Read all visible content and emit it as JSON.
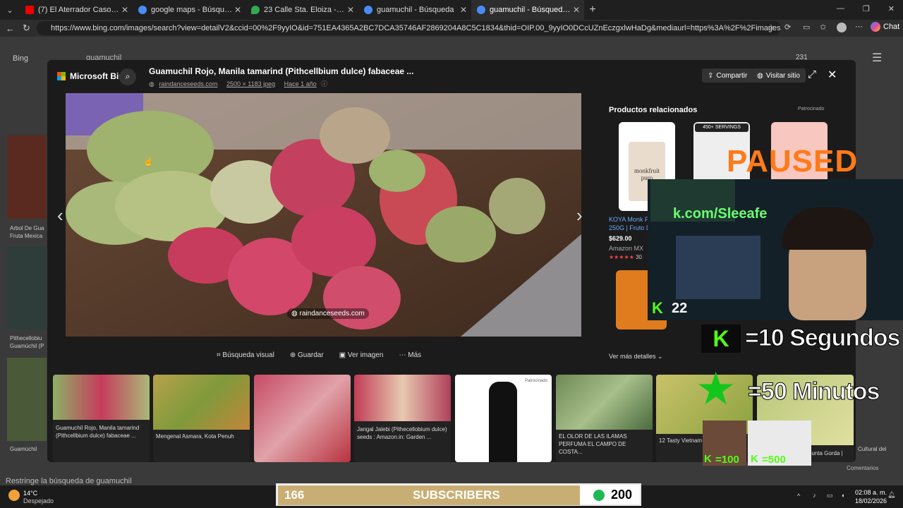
{
  "browser": {
    "tabs": [
      {
        "title": "(7) El Aterrador Caso de LA PENSI",
        "color": "#e00"
      },
      {
        "title": "google maps - Búsqueda",
        "color": "#4a8cf7"
      },
      {
        "title": "23 Calle Sta. Eloiza - Google Maps",
        "color": "#34a853"
      },
      {
        "title": "guamuchil - Búsqueda",
        "color": "#4a8cf7"
      },
      {
        "title": "guamuchil - Búsqueda Imágenes",
        "color": "#4a8cf7"
      }
    ],
    "url": "https://www.bing.com/images/search?view=detailV2&ccid=00%2F9yyIO&id=751EA4365A2BC7DCA35746AF2869204A8C5C1834&thid=OIP.00_9yyIO0DCcUZnEczgxlwHaDg&mediaurl=https%3A%2F%2Fimages.squarespace-cdn.com%2Fconten...",
    "chat_label": "Chat"
  },
  "bing": {
    "logo": "Microsoft Bing",
    "title": "Guamuchil Rojo, Manila tamarind (Pithcellbium dulce) fabaceae ...",
    "source": "raindanceseeds.com",
    "size": "2500 × 1183 jpeg",
    "age": "Hace 1 año",
    "share": "Compartir",
    "visit": "Visitar sitio",
    "image_watermark": "raindanceseeds.com",
    "related_title": "Productos relacionados",
    "sponsored": "Patrocinado",
    "product_name": "KOYA Monk F 250G | Fruto D",
    "product_price": "$629.00",
    "product_store": "Amazon MX",
    "product_rating_count": "30",
    "product_label": "monkfruit puro",
    "product2_badge": "450+ SERVINGS",
    "ver_mas": "Ver más detalles",
    "actions": {
      "visual": "Búsqueda visual",
      "save": "Guardar",
      "view": "Ver imagen",
      "more": "Más"
    },
    "thumbs": [
      "Guamuchil Rojo, Manila tamarind (Pithcellbium dulce) fabaceae ...",
      "Mengenal Asmara, Kota Penuh",
      "",
      "Jangal Jalebi (Pithecellobium dulce) seeds : Amazon.in: Garden ...",
      "Patrocinado",
      "EL OLOR DE LAS ILAMAS PERFUMA EL CAMPO DE COSTA...",
      "12 Tasty Vietnam On Your Next Tri",
      "Punta Gorda |"
    ],
    "bg_search": "guamuchil",
    "bg_rewards": "231",
    "bg_restrict": "Restringe la búsqueda de guamuchil",
    "bg_comments": "Comentarios",
    "bg_left_labels": [
      "Arbol De Gua Fruta Mexica",
      "Pithecellobiu Guamúchil (P",
      "Guamúchil"
    ],
    "bg_right_labels": [
      "Cultural del"
    ]
  },
  "stream": {
    "paused": "PAUSED",
    "kick_url": "k.com/Sleeafe",
    "viewers": "22",
    "rule1": "=10 Segundos",
    "rule2": "=50 Minutos",
    "badge1": "=100",
    "badge2": "=500",
    "subs_count": "166",
    "subs_label": "SUBSCRIBERS",
    "subs_goal": "200"
  },
  "taskbar": {
    "temp": "14°C",
    "weather": "Despejado",
    "time": "02:08 a. m.",
    "date": "18/02/2026"
  }
}
